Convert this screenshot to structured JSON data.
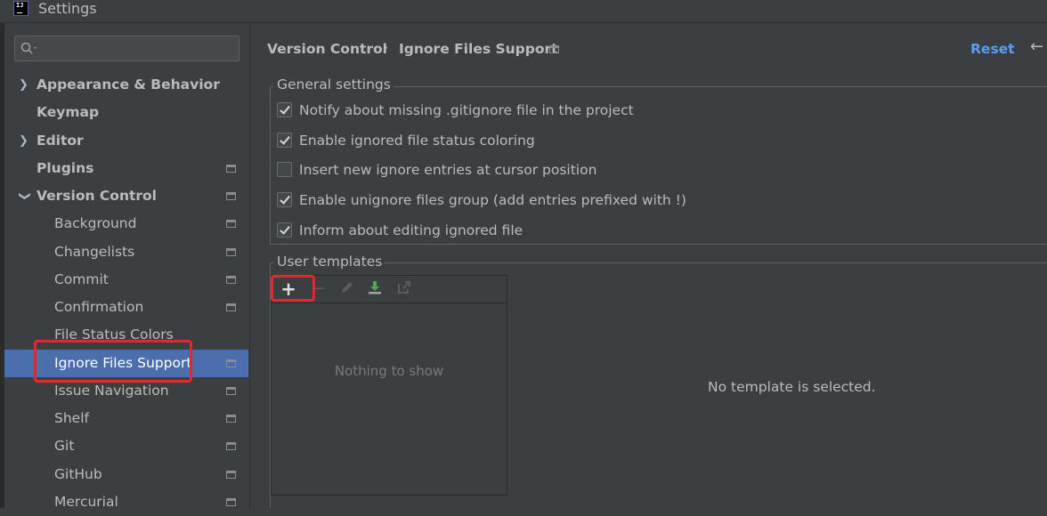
{
  "window": {
    "title": "Settings",
    "app_icon_text": "IJ"
  },
  "search": {
    "placeholder": ""
  },
  "sidebar": {
    "items": [
      {
        "label": "Appearance & Behavior",
        "expandable": true,
        "expanded": false,
        "bold": true
      },
      {
        "label": "Keymap",
        "bold": true
      },
      {
        "label": "Editor",
        "expandable": true,
        "expanded": false,
        "bold": true
      },
      {
        "label": "Plugins",
        "bold": true,
        "project_icon": true
      },
      {
        "label": "Version Control",
        "expandable": true,
        "expanded": true,
        "bold": true,
        "project_icon": true
      },
      {
        "label": "Background",
        "project_icon": true
      },
      {
        "label": "Changelists",
        "project_icon": true
      },
      {
        "label": "Commit",
        "project_icon": true
      },
      {
        "label": "Confirmation",
        "project_icon": true
      },
      {
        "label": "File Status Colors"
      },
      {
        "label": "Ignore Files Support",
        "selected": true,
        "project_icon": true
      },
      {
        "label": "Issue Navigation",
        "project_icon": true
      },
      {
        "label": "Shelf",
        "project_icon": true
      },
      {
        "label": "Git",
        "project_icon": true
      },
      {
        "label": "GitHub",
        "project_icon": true
      },
      {
        "label": "Mercurial",
        "project_icon": true
      }
    ]
  },
  "breadcrumb": {
    "parent": "Version Control",
    "separator": "›",
    "current": "Ignore Files Support"
  },
  "header": {
    "reset_label": "Reset",
    "back_icon": "arrow-left-icon"
  },
  "general_settings": {
    "title": "General settings",
    "options": [
      {
        "label": "Notify about missing .gitignore file in the project",
        "checked": true
      },
      {
        "label": "Enable ignored file status coloring",
        "checked": true
      },
      {
        "label": "Insert new ignore entries at cursor position",
        "checked": false
      },
      {
        "label": "Enable unignore files group (add entries prefixed with !)",
        "checked": true
      },
      {
        "label": "Inform about editing ignored file",
        "checked": true
      }
    ]
  },
  "user_templates": {
    "title": "User templates",
    "toolbar": {
      "add": "+",
      "remove": "−"
    },
    "empty_text": "Nothing to show",
    "detail_text": "No template is selected."
  },
  "colors": {
    "background": "#3c3f41",
    "selection": "#4b6eaf",
    "link": "#589df6",
    "highlight_annotation": "#e0282e"
  }
}
